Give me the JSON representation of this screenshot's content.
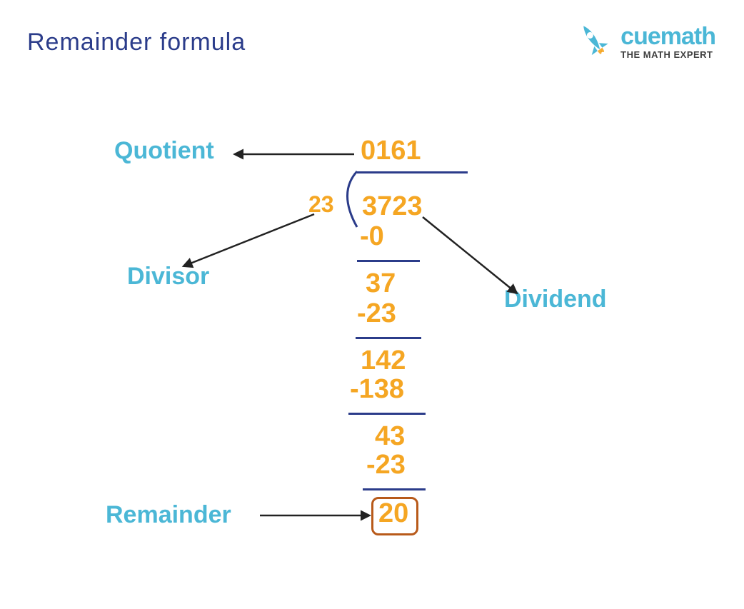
{
  "title": "Remainder formula",
  "logo": {
    "brand": "cuemath",
    "tagline": "THE MATH EXPERT"
  },
  "labels": {
    "quotient": "Quotient",
    "divisor": "Divisor",
    "dividend": "Dividend",
    "remainder": "Remainder"
  },
  "division": {
    "quotient": "0161",
    "divisor": "23",
    "dividend": "3723",
    "remainder": "20",
    "steps": [
      {
        "partial": "",
        "subtract": "-0"
      },
      {
        "partial": "37",
        "subtract": "-23"
      },
      {
        "partial": "142",
        "subtract": "-138"
      },
      {
        "partial": "43",
        "subtract": "-23"
      }
    ]
  }
}
